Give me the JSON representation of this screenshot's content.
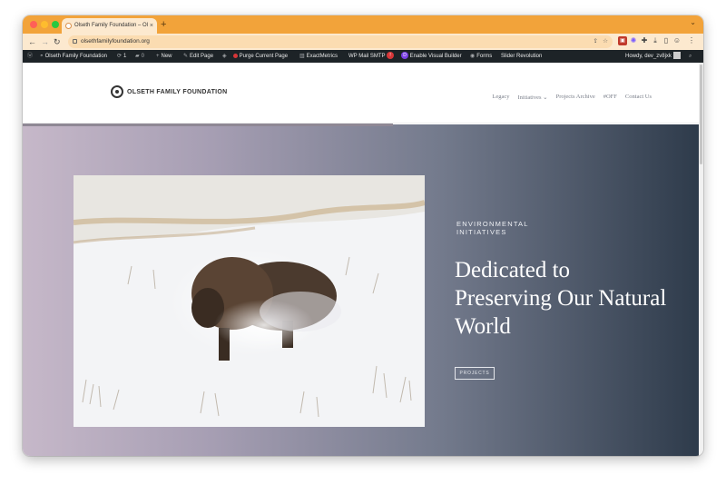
{
  "browser": {
    "tab_title": "Olseth Family Foundation – Ol",
    "tab_close": "×",
    "new_tab": "+",
    "tab_menu": "⌄",
    "url": "olsethfamilyfoundation.org"
  },
  "admin_bar": {
    "site_name": "Olseth Family Foundation",
    "updates_count": "1",
    "comments_count": "0",
    "new_label": "New",
    "edit_page": "Edit Page",
    "purge": "Purge Current Page",
    "exactmetrics": "ExactMetrics",
    "wp_mail_smtp": "WP Mail SMTP",
    "smtp_badge": "!",
    "visual_builder": "Enable Visual Builder",
    "forms": "Forms",
    "slider_revolution": "Slider Revolution",
    "greeting": "Howdy, dev_zv8jxk"
  },
  "site": {
    "logo_text": "OLSETH FAMILY FOUNDATION",
    "nav": [
      {
        "label": "Legacy"
      },
      {
        "label": "Initiatives ⌄"
      },
      {
        "label": "Projects Archive"
      },
      {
        "label": "#OFF"
      },
      {
        "label": "Contact Us"
      }
    ]
  },
  "hero": {
    "eyebrow": "ENVIRONMENTAL INITIATIVES",
    "headline": "Dedicated to Preserving Our Natural World",
    "button": "PROJECTS"
  },
  "colors": {
    "tab_strip": "#f2a33a",
    "toolbar": "#fce9cf",
    "admin_bar": "#1d2327",
    "hero_gradient_start": "#c6b8c9",
    "hero_gradient_end": "#2e3b4b"
  },
  "icons": {
    "back": "back-arrow-icon",
    "forward": "forward-arrow-icon",
    "reload": "reload-icon",
    "share": "share-icon",
    "bookmark": "star-icon",
    "extensions": "puzzle-icon",
    "download": "download-icon",
    "sidepanel": "side-panel-icon",
    "menu": "kebab-menu-icon"
  }
}
